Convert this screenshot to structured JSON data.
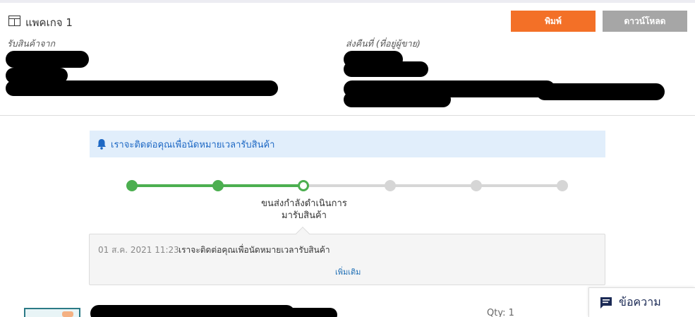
{
  "header": {
    "package_title": "แพคเกจ 1",
    "print_label": "พิมพ์",
    "download_label": "ดาวน์โหลด",
    "icons": {
      "package": "package-icon"
    }
  },
  "pickup": {
    "label": "รับสินค้าจาก"
  },
  "return_address": {
    "label": "ส่งคืนที่ (ที่อยู่ผู้ขาย)"
  },
  "notice": {
    "text": "เราจะติดต่อคุณเพื่อนัดหมายเวลารับสินค้า",
    "icon": "bell-icon"
  },
  "progress": {
    "steps_total": 6,
    "completed": 2,
    "current_index": 2,
    "current_label_line1": "ขนส่งกำลังดำเนินการ",
    "current_label_line2": "มารับสินค้า"
  },
  "log": {
    "time": "01 ส.ค. 2021 11:23",
    "message": "เราจะติดต่อคุณเพื่อนัดหมายเวลารับสินค้า",
    "more_label": "เพิ่มเติม"
  },
  "item": {
    "qty_label": "Qty: 1"
  },
  "chat": {
    "label": "ข้อความ",
    "icon": "chat-icon"
  },
  "colors": {
    "accent": "#f37027",
    "download": "#a6a6a6",
    "progress_done": "#4caf50",
    "progress_todo": "#d6d6d6",
    "notice_bg": "#e1eefb",
    "link": "#1d68c4"
  }
}
